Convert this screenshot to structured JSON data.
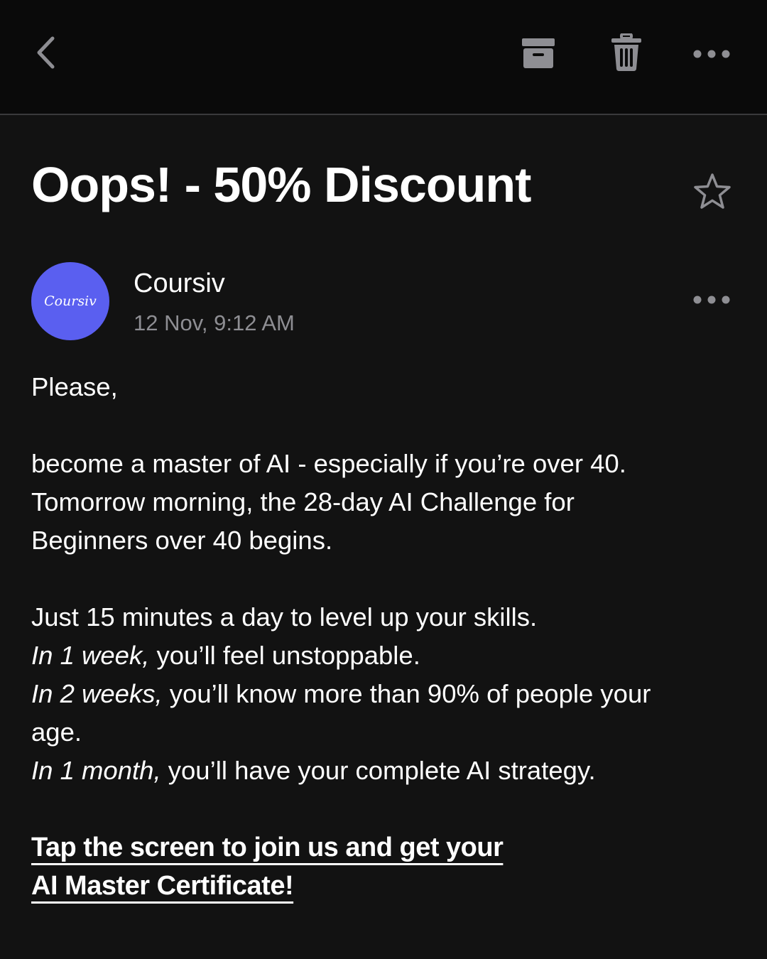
{
  "toolbar": {
    "back_icon": "chevron-left-icon",
    "archive_icon": "archive-box-icon",
    "trash_icon": "trash-icon",
    "more_icon": "ellipsis-icon",
    "icon_color": "#8e8e93"
  },
  "email": {
    "subject": "Oops! - 50% Discount",
    "star_icon": "star-outline-icon",
    "sender": {
      "name": "Coursiv",
      "date": "12 Nov, 9:12 AM",
      "avatar_text": "Coursiv",
      "avatar_color": "#5a5ff0"
    },
    "body": {
      "greeting": "Please,",
      "para1_line1": "become a master of AI - especially if you’re over 40.",
      "para1_line2": "Tomorrow morning, the 28-day AI Challenge for",
      "para1_line3": "Beginners over 40 begins.",
      "para2_line1": "Just 15 minutes a day to level up your skills.",
      "week1_lead": "In 1 week,",
      "week1_rest": " you’ll feel unstoppable.",
      "week2_lead": "In 2 weeks,",
      "week2_rest": " you’ll know more than 90% of people your",
      "week2_cont": "age.",
      "month1_lead": "In 1 month,",
      "month1_rest": " you’ll have your complete AI strategy."
    },
    "cta": {
      "line1": "Tap the screen to join us and get your ",
      "line2": "AI Master Certificate!"
    }
  }
}
